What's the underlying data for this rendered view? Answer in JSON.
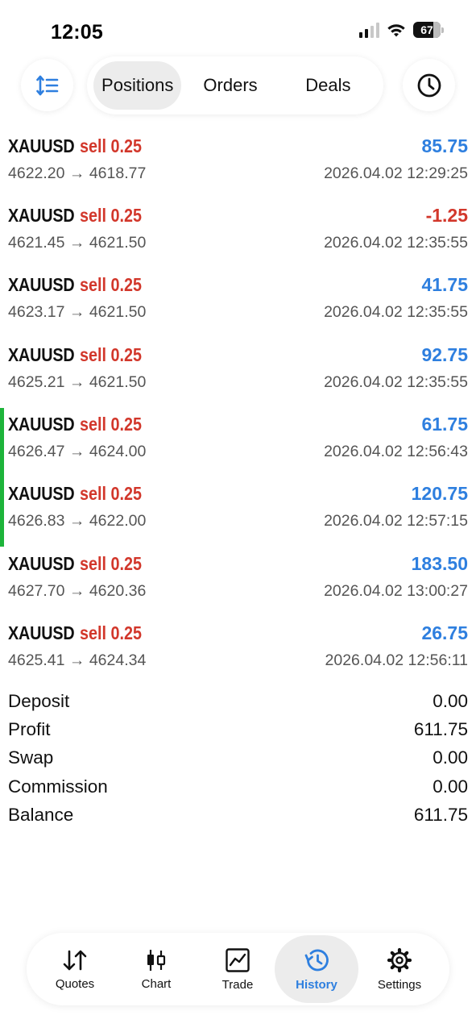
{
  "status": {
    "time": "12:05",
    "battery": "67"
  },
  "segments": [
    "Positions",
    "Orders",
    "Deals"
  ],
  "positions": [
    {
      "symbol": "XAUUSD",
      "side": "sell 0.25",
      "profit": "85.75",
      "profit_sign": "pos",
      "prices": "4622.20 → 4618.77",
      "time": "2026.04.02 12:29:25",
      "marked": false
    },
    {
      "symbol": "XAUUSD",
      "side": "sell 0.25",
      "profit": "-1.25",
      "profit_sign": "neg",
      "prices": "4621.45 → 4621.50",
      "time": "2026.04.02 12:35:55",
      "marked": false
    },
    {
      "symbol": "XAUUSD",
      "side": "sell 0.25",
      "profit": "41.75",
      "profit_sign": "pos",
      "prices": "4623.17 → 4621.50",
      "time": "2026.04.02 12:35:55",
      "marked": false
    },
    {
      "symbol": "XAUUSD",
      "side": "sell 0.25",
      "profit": "92.75",
      "profit_sign": "pos",
      "prices": "4625.21 → 4621.50",
      "time": "2026.04.02 12:35:55",
      "marked": false
    },
    {
      "symbol": "XAUUSD",
      "side": "sell 0.25",
      "profit": "61.75",
      "profit_sign": "pos",
      "prices": "4626.47 → 4624.00",
      "time": "2026.04.02 12:56:43",
      "marked": true
    },
    {
      "symbol": "XAUUSD",
      "side": "sell 0.25",
      "profit": "120.75",
      "profit_sign": "pos",
      "prices": "4626.83 → 4622.00",
      "time": "2026.04.02 12:57:15",
      "marked": true
    },
    {
      "symbol": "XAUUSD",
      "side": "sell 0.25",
      "profit": "183.50",
      "profit_sign": "pos",
      "prices": "4627.70 → 4620.36",
      "time": "2026.04.02 13:00:27",
      "marked": false
    },
    {
      "symbol": "XAUUSD",
      "side": "sell 0.25",
      "profit": "26.75",
      "profit_sign": "pos",
      "prices": "4625.41 → 4624.34",
      "time": "2026.04.02 12:56:11",
      "marked": false
    }
  ],
  "summary": [
    {
      "label": "Deposit",
      "value": "0.00"
    },
    {
      "label": "Profit",
      "value": "611.75"
    },
    {
      "label": "Swap",
      "value": "0.00"
    },
    {
      "label": "Commission",
      "value": "0.00"
    },
    {
      "label": "Balance",
      "value": "611.75"
    }
  ],
  "nav": [
    {
      "label": "Quotes",
      "icon": "quotes-arrows-icon"
    },
    {
      "label": "Chart",
      "icon": "candlestick-icon"
    },
    {
      "label": "Trade",
      "icon": "trade-chart-icon"
    },
    {
      "label": "History",
      "icon": "history-icon",
      "active": true
    },
    {
      "label": "Settings",
      "icon": "gear-icon"
    }
  ],
  "colors": {
    "accent": "#2e7fdf",
    "sell": "#d2372b",
    "marker": "#1db43a"
  }
}
